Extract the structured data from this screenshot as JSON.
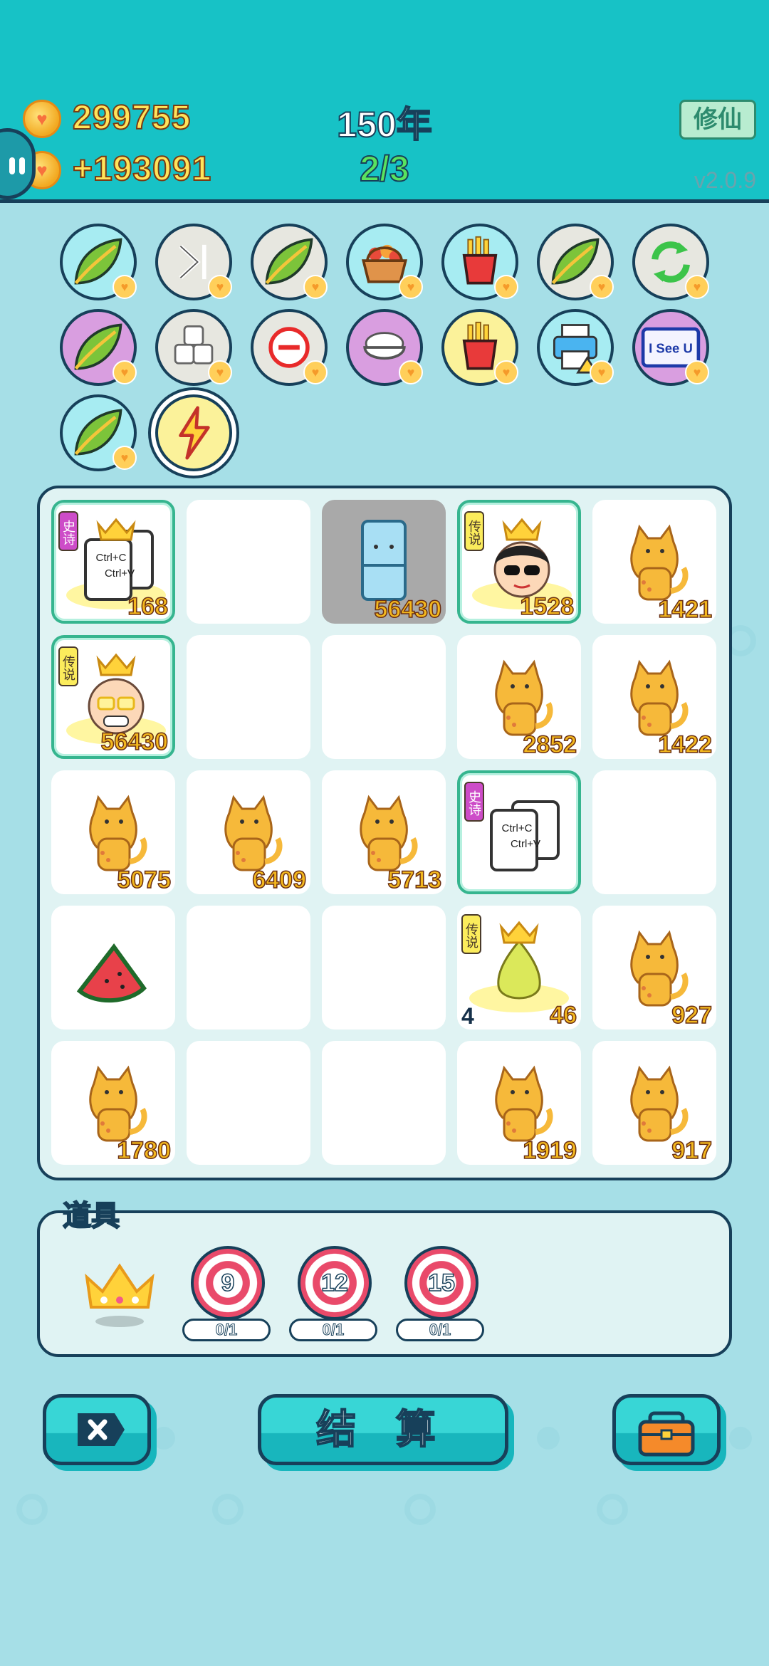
{
  "header": {
    "coins": "299755",
    "gain": "+193091",
    "year": "150年",
    "round": "2/3",
    "cultivate_button": "修仙",
    "version": "v2.0.9"
  },
  "relics": [
    {
      "name": "leaf-icon",
      "bg": "#a7ecf2"
    },
    {
      "name": "skip-icon",
      "bg": "#e7e7e0"
    },
    {
      "name": "leaf-icon",
      "bg": "#e7e7e0"
    },
    {
      "name": "fruit-basket-icon",
      "bg": "#a7ecf2"
    },
    {
      "name": "fries-icon",
      "bg": "#a7ecf2"
    },
    {
      "name": "leaf-icon",
      "bg": "#e7e7e0"
    },
    {
      "name": "refresh-icon",
      "bg": "#e7e7e0"
    },
    {
      "name": "leaf-icon",
      "bg": "#d99ee0"
    },
    {
      "name": "cubes-icon",
      "bg": "#e7e7e0"
    },
    {
      "name": "minus-icon",
      "bg": "#e7e7e0"
    },
    {
      "name": "rice-bowl-icon",
      "bg": "#d99ee0"
    },
    {
      "name": "fries-icon",
      "bg": "#fbf29a"
    },
    {
      "name": "printer-icon",
      "bg": "#a7ecf2"
    },
    {
      "name": "i-see-u-icon",
      "bg": "#d99ee0",
      "label": "I See U"
    },
    {
      "name": "leaf-icon",
      "bg": "#a7ecf2"
    },
    {
      "name": "lightning-icon",
      "bg": "#fbf29a"
    }
  ],
  "board": {
    "cells": [
      {
        "icon": "copy-paste-icon",
        "value": "168",
        "tag": "史诗",
        "tag_type": "epic",
        "crown": true,
        "framed": true,
        "glow": true
      },
      {
        "icon": "",
        "value": ""
      },
      {
        "icon": "fridge-icon",
        "value": "56430",
        "gray": true
      },
      {
        "icon": "sunglasses-man-icon",
        "value": "1528",
        "tag": "传说",
        "tag_type": "legend",
        "crown": true,
        "framed": true,
        "glow": true
      },
      {
        "icon": "cat-icon",
        "value": "1421"
      },
      {
        "icon": "old-man-icon",
        "value": "56430",
        "tag": "传说",
        "tag_type": "legend",
        "crown": true,
        "framed": true,
        "glow": true
      },
      {
        "icon": "",
        "value": ""
      },
      {
        "icon": "",
        "value": ""
      },
      {
        "icon": "cat-icon",
        "value": "2852"
      },
      {
        "icon": "cat-icon",
        "value": "1422"
      },
      {
        "icon": "cat-icon",
        "value": "5075"
      },
      {
        "icon": "cat-icon",
        "value": "6409"
      },
      {
        "icon": "cat-icon",
        "value": "5713"
      },
      {
        "icon": "copy-paste-icon",
        "value": "",
        "tag": "史诗",
        "tag_type": "epic",
        "framed": true
      },
      {
        "icon": "",
        "value": ""
      },
      {
        "icon": "watermelon-icon",
        "value": ""
      },
      {
        "icon": "",
        "value": ""
      },
      {
        "icon": "",
        "value": ""
      },
      {
        "icon": "pear-icon",
        "value": "46",
        "left_value": "4",
        "tag": "传说",
        "tag_type": "legend",
        "crown": true,
        "glow": true
      },
      {
        "icon": "cat-icon",
        "value": "927"
      },
      {
        "icon": "cat-icon",
        "value": "1780"
      },
      {
        "icon": "",
        "value": ""
      },
      {
        "icon": "",
        "value": ""
      },
      {
        "icon": "cat-icon",
        "value": "1919"
      },
      {
        "icon": "cat-icon",
        "value": "917"
      }
    ],
    "copy_text_1": "Ctrl+C",
    "copy_text_2": "Ctrl+V"
  },
  "props": {
    "title": "道具",
    "items": [
      {
        "icon": "crown-icon"
      },
      {
        "icon": "target-icon",
        "value": "9",
        "count": "0/1"
      },
      {
        "icon": "target-icon",
        "value": "12",
        "count": "0/1"
      },
      {
        "icon": "target-icon",
        "value": "15",
        "count": "0/1"
      }
    ]
  },
  "buttons": {
    "close_icon": "close-icon",
    "settle_label": "结 算",
    "bag_icon": "briefcase-icon"
  }
}
